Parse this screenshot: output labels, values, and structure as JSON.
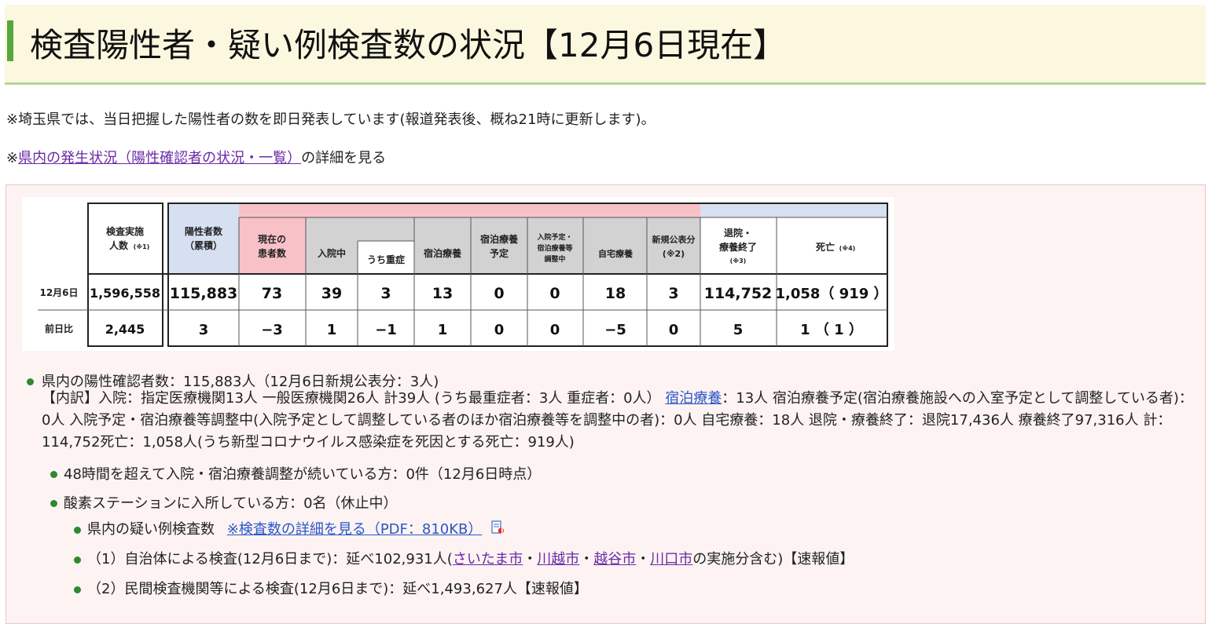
{
  "page": {
    "title": "検査陽性者・疑い例検査数の状況【12月6日現在】",
    "note1": "※埼玉県では、当日把握した陽性者の数を即日発表しています(報道発表後、概ね21時に更新します)。",
    "note2_prefix": "※",
    "note2_link": "県内の発生状況（陽性確認者の状況・一覧）",
    "note2_suffix": "の詳細を見る"
  },
  "colors": {
    "header_blue": "#d6e0f0",
    "header_pink": "#f8c1c8",
    "header_gray": "#d2d2d2",
    "bullet_green": "#2d8a2d",
    "title_bg": "#fbf8df",
    "title_accent": "#55a63e"
  },
  "table": {
    "headers": {
      "tested": "検査実施",
      "tested2": "人数",
      "tested_note": "(※1)",
      "positive": "陽性者数",
      "positive2": "（累積）",
      "current": "現在の",
      "current2": "患者数",
      "hospital": "入院中",
      "severe": "うち重症",
      "hotel": "宿泊療養",
      "hotel_plan": "宿泊療養",
      "hotel_plan2": "予定",
      "adjust1": "入院予定・",
      "adjust2": "宿泊療養等",
      "adjust3": "調整中",
      "home": "自宅療養",
      "newpub": "新規公表分",
      "newpub_note": "(※2)",
      "discharged1": "退院・",
      "discharged2": "療養終了",
      "discharged_note": "(※3)",
      "death": "死亡",
      "death_note": "(※4)"
    },
    "row1": {
      "label": "12月6日",
      "tested": "1,596,558",
      "positive": "115,883",
      "current": "73",
      "hospital": "39",
      "severe": "3",
      "hotel": "13",
      "hotel_plan": "0",
      "adjust": "0",
      "home": "18",
      "newpub": "3",
      "discharged": "114,752",
      "death": "1,058（ 919 ）"
    },
    "row2": {
      "label": "前日比",
      "tested": "2,445",
      "positive": "3",
      "current": "−3",
      "hospital": "1",
      "severe": "−1",
      "hotel": "1",
      "hotel_plan": "0",
      "adjust": "0",
      "home": "−5",
      "newpub": "0",
      "discharged": "5",
      "death": "1 （  1  ）"
    }
  },
  "bullets": {
    "b1": "県内の陽性確認者数：115,883人（12月6日新規公表分：3人)",
    "detail_a": "【内訳】入院：指定医療機関13人 一般医療機関26人 計39人 (うち最重症者：3人 重症者：0人）",
    "detail_link": "宿泊療養",
    "detail_b": "：13人 宿泊療養予定(宿泊療養施設への入室予定として調整している者)：0人 入院予定・宿泊療養等調整中(入院予定として調整している者のほか宿泊療養等を調整中の者)：0人 自宅療養：18人 退院・療養終了：退院17,436人 療養終了97,316人 計：114,752死亡：1,058人(うち新型コロナウイルス感染症を死因とする死亡：919人)",
    "b2": "48時間を超えて入院・宿泊療養調整が続いている方：0件（12月6日時点）",
    "b3": "酸素ステーションに入所している方：0名（休止中）",
    "b4_text": "県内の疑い例検査数",
    "b4_link": "※検査数の詳細を見る（PDF：810KB）",
    "b5_a": "（1）自治体による検査(12月6日まで)：延べ102,931人(",
    "b5_l1": "さいたま市",
    "b5_sep1": "・",
    "b5_l2": "川越市",
    "b5_sep2": "・",
    "b5_l3": "越谷市",
    "b5_sep3": "・",
    "b5_l4": "川口市",
    "b5_b": "の実施分含む)【速報値】",
    "b6": "（2）民間検査機関等による検査(12月6日まで)：延べ1,493,627人【速報値】"
  }
}
